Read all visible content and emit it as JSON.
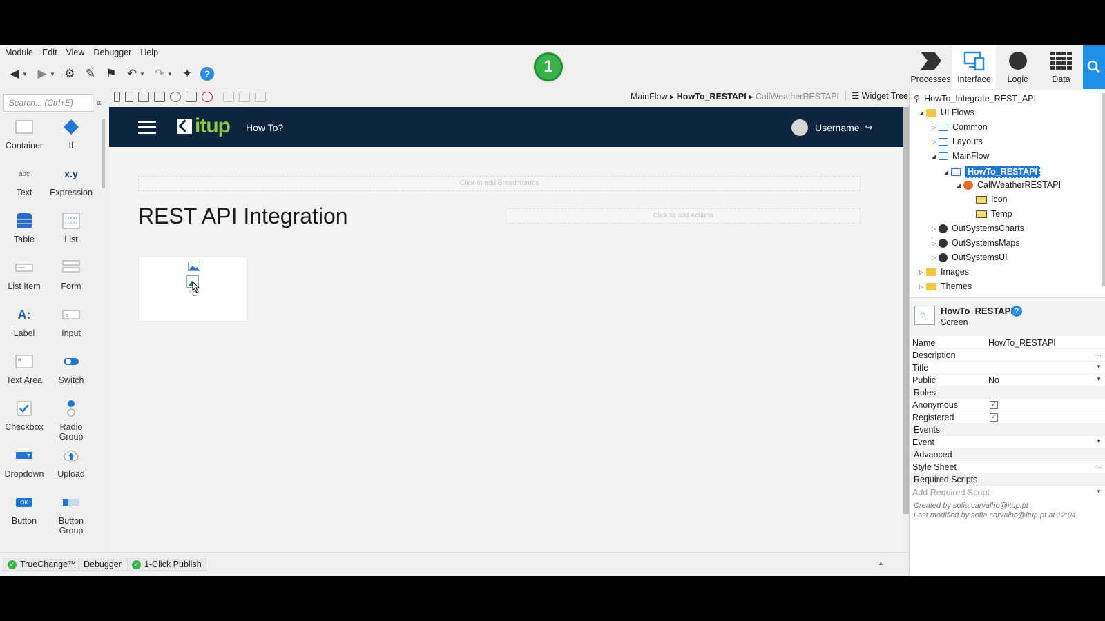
{
  "menu": [
    "Module",
    "Edit",
    "View",
    "Debugger",
    "Help"
  ],
  "step_badge": "1",
  "tabs": [
    {
      "label": "Processes",
      "icon": "processes-icon"
    },
    {
      "label": "Interface",
      "icon": "interface-icon"
    },
    {
      "label": "Logic",
      "icon": "logic-icon"
    },
    {
      "label": "Data",
      "icon": "data-icon"
    }
  ],
  "search": {
    "placeholder": "Search... (Ctrl+E)"
  },
  "toolbox": [
    {
      "label": "Container",
      "icon": "container-icon"
    },
    {
      "label": "If",
      "icon": "if-icon"
    },
    {
      "label": "Text",
      "icon": "text-icon",
      "glyph": "abc"
    },
    {
      "label": "Expression",
      "icon": "expression-icon",
      "glyph": "x.y"
    },
    {
      "label": "Table",
      "icon": "table-icon"
    },
    {
      "label": "List",
      "icon": "list-icon"
    },
    {
      "label": "List Item",
      "icon": "list-item-icon"
    },
    {
      "label": "Form",
      "icon": "form-icon"
    },
    {
      "label": "Label",
      "icon": "label-icon",
      "glyph": "A:"
    },
    {
      "label": "Input",
      "icon": "input-icon"
    },
    {
      "label": "Text Area",
      "icon": "text-area-icon"
    },
    {
      "label": "Switch",
      "icon": "switch-icon"
    },
    {
      "label": "Checkbox",
      "icon": "checkbox-icon"
    },
    {
      "label": "Radio Group",
      "icon": "radio-group-icon"
    },
    {
      "label": "Dropdown",
      "icon": "dropdown-icon"
    },
    {
      "label": "Upload",
      "icon": "upload-icon"
    },
    {
      "label": "Button",
      "icon": "button-icon",
      "glyph": "OK"
    },
    {
      "label": "Button Group",
      "icon": "button-group-icon"
    }
  ],
  "breadcrumb": {
    "first": "MainFlow",
    "second": "HowTo_RESTAPI",
    "third": "CallWeatherRESTAPI"
  },
  "widget_tree": "Widget Tree",
  "canvas": {
    "logo_text": "itup",
    "howto": "How To?",
    "username": "Username",
    "breadcrumbs_placeholder": "Click to add Breadcrumbs",
    "actions_placeholder": "Click to add Actions",
    "title": "REST API Integration",
    "temp_unit": "°C"
  },
  "tree": {
    "root": "HowTo_Integrate_REST_API",
    "ui_flows": "UI Flows",
    "common": "Common",
    "layouts": "Layouts",
    "mainflow": "MainFlow",
    "screen": "HowTo_RESTAPI",
    "block": "CallWeatherRESTAPI",
    "icon": "Icon",
    "temp": "Temp",
    "charts": "OutSystemsCharts",
    "maps": "OutSystemsMaps",
    "ui": "OutSystemsUI",
    "images": "Images",
    "themes": "Themes"
  },
  "properties": {
    "name": "HowTo_RESTAPI",
    "type": "Screen",
    "rows": {
      "name_label": "Name",
      "name_value": "HowTo_RESTAPI",
      "description_label": "Description",
      "title_label": "Title",
      "public_label": "Public",
      "public_value": "No",
      "roles_section": "Roles",
      "anonymous_label": "Anonymous",
      "registered_label": "Registered",
      "events_section": "Events",
      "event_label": "Event",
      "advanced_section": "Advanced",
      "stylesheet_label": "Style Sheet",
      "required_scripts_section": "Required Scripts",
      "add_required_script": "Add Required Script"
    },
    "anonymous_checked": true,
    "registered_checked": true,
    "created_by": "Created by sofia.carvalho@itup.pt",
    "modified_by": "Last modified by sofia.carvalho@itup.pt at 12:04"
  },
  "status_tabs": [
    "TrueChange™",
    "Debugger",
    "1-Click Publish"
  ],
  "colors": {
    "header_bg": "#0d2541",
    "accent": "#1f8fe8",
    "logo_green": "#8dc63f",
    "ok_green": "#38b24a"
  }
}
